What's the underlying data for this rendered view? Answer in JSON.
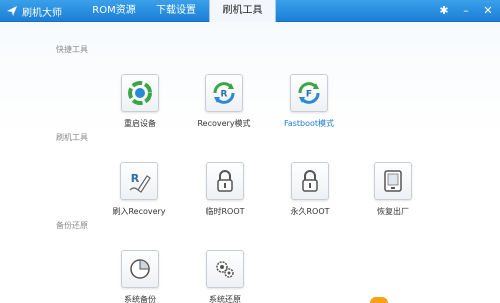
{
  "app": {
    "title": "刷机大师"
  },
  "tabs": [
    {
      "label": "刷机大师",
      "active": false
    },
    {
      "label": "ROM资源",
      "active": false
    },
    {
      "label": "下载设置",
      "active": false
    },
    {
      "label": "刷机工具",
      "active": true
    }
  ],
  "sections": {
    "quick": {
      "title": "快捷工具"
    },
    "flash": {
      "title": "刷机工具"
    },
    "backup": {
      "title": "备份还原"
    }
  },
  "tools": {
    "reboot": {
      "label": "重启设备",
      "icon": "reboot-icon"
    },
    "recovery_mode": {
      "label": "Recovery模式",
      "icon": "recovery-mode-icon"
    },
    "fastboot_mode": {
      "label": "Fastboot模式",
      "icon": "fastboot-mode-icon"
    },
    "flash_recovery": {
      "label": "刷入Recovery",
      "icon": "flash-recovery-icon"
    },
    "temp_root": {
      "label": "临时ROOT",
      "icon": "temp-root-icon"
    },
    "perm_root": {
      "label": "永久ROOT",
      "icon": "perm-root-icon"
    },
    "factory_reset": {
      "label": "恢复出厂",
      "icon": "factory-reset-icon"
    },
    "system_backup": {
      "label": "系统备份",
      "icon": "system-backup-icon"
    },
    "system_restore": {
      "label": "系统还原",
      "icon": "system-restore-icon"
    }
  },
  "colors": {
    "topbar": "#1c7fd6",
    "accent": "#1f7ad0",
    "green": "#3aa547",
    "blue": "#2a8ad8"
  }
}
